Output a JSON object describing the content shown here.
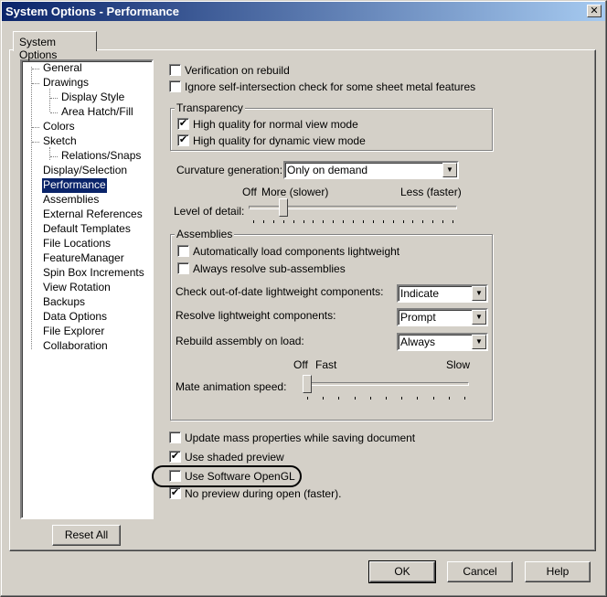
{
  "window": {
    "title": "System Options - Performance",
    "close_glyph": "✕"
  },
  "tab": {
    "label": "System Options"
  },
  "tree": {
    "items": [
      {
        "label": "General"
      },
      {
        "label": "Drawings"
      },
      {
        "label": "Display Style"
      },
      {
        "label": "Area Hatch/Fill"
      },
      {
        "label": "Colors"
      },
      {
        "label": "Sketch"
      },
      {
        "label": "Relations/Snaps"
      },
      {
        "label": "Display/Selection"
      },
      {
        "label": "Performance",
        "selected": true
      },
      {
        "label": "Assemblies"
      },
      {
        "label": "External References"
      },
      {
        "label": "Default Templates"
      },
      {
        "label": "File Locations"
      },
      {
        "label": "FeatureManager"
      },
      {
        "label": "Spin Box Increments"
      },
      {
        "label": "View Rotation"
      },
      {
        "label": "Backups"
      },
      {
        "label": "Data Options"
      },
      {
        "label": "File Explorer"
      },
      {
        "label": "Collaboration"
      }
    ]
  },
  "reset_button": {
    "label": "Reset All"
  },
  "options": {
    "verification": {
      "label": "Verification on rebuild",
      "checked": false
    },
    "ignore_self_intersection": {
      "label": "Ignore self-intersection check for some sheet metal features",
      "checked": false
    }
  },
  "transparency": {
    "title": "Transparency",
    "normal": {
      "label": "High quality for normal view mode",
      "checked": true
    },
    "dynamic": {
      "label": "High quality for dynamic view mode",
      "checked": true
    }
  },
  "curvature": {
    "label": "Curvature generation:",
    "value": "Only on demand"
  },
  "level_of_detail": {
    "label": "Level of detail:",
    "off_label": "Off",
    "more_label": "More (slower)",
    "less_label": "Less (faster)",
    "level": 0.15
  },
  "assemblies": {
    "title": "Assemblies",
    "auto_lightweight": {
      "label": "Automatically load components lightweight",
      "checked": false
    },
    "resolve_sub": {
      "label": "Always resolve sub-assemblies",
      "checked": false
    },
    "check_outdated": {
      "label": "Check out-of-date lightweight components:",
      "value": "Indicate"
    },
    "resolve_lightweight": {
      "label": "Resolve lightweight components:",
      "value": "Prompt"
    },
    "rebuild_on_load": {
      "label": "Rebuild assembly on load:",
      "value": "Always"
    },
    "mate_animation": {
      "label": "Mate animation speed:",
      "off_label": "Off",
      "fast_label": "Fast",
      "slow_label": "Slow",
      "level": 0.0
    }
  },
  "bottom_options": {
    "update_mass": {
      "label": "Update mass properties while saving document",
      "checked": false
    },
    "shaded_preview": {
      "label": "Use shaded preview",
      "checked": true
    },
    "software_opengl": {
      "label": "Use Software OpenGL",
      "checked": false
    },
    "no_preview": {
      "label": "No preview during open (faster).",
      "checked": true
    }
  },
  "buttons": {
    "ok": "OK",
    "cancel": "Cancel",
    "help": "Help"
  }
}
